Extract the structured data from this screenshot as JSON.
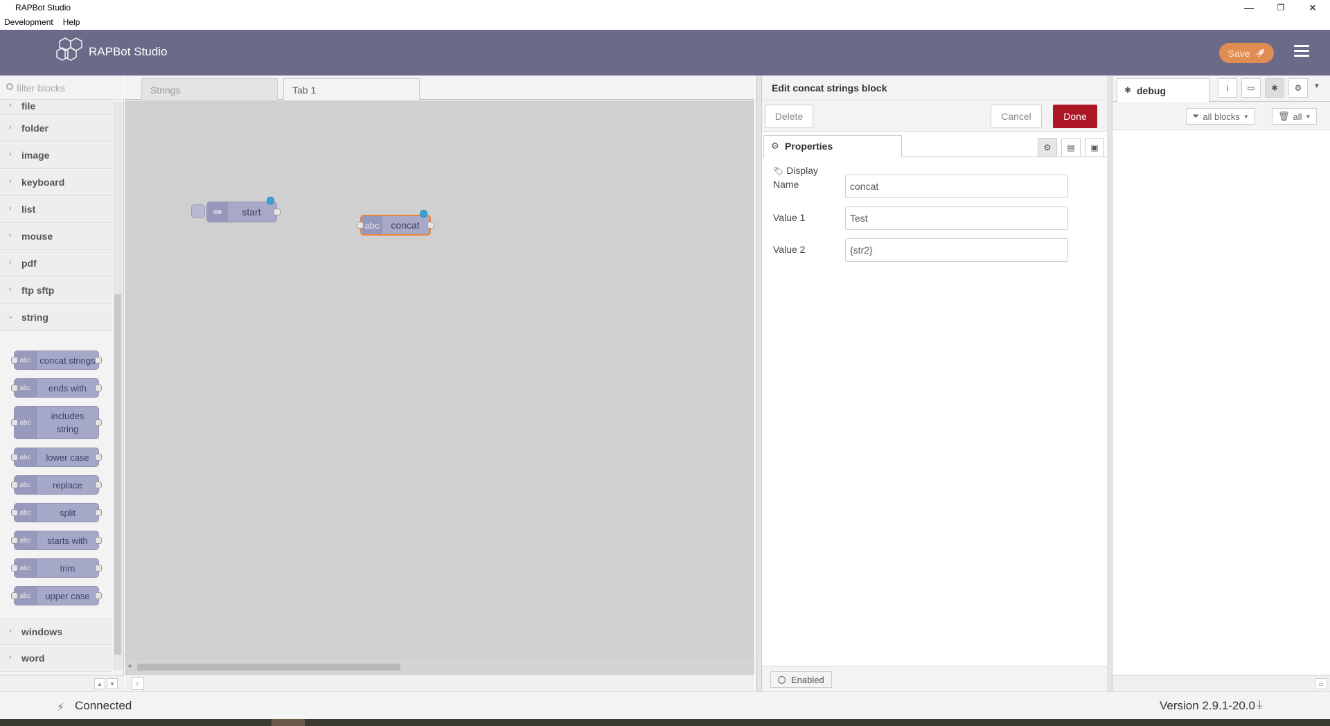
{
  "window": {
    "title": "RAPBot Studio",
    "controls": {
      "minimize": "—",
      "maximize": "❐",
      "close": "✕"
    }
  },
  "menu": {
    "items": [
      "Development",
      "Help"
    ]
  },
  "header": {
    "brand": "RAPBot Studio",
    "save_label": "Save"
  },
  "palette": {
    "filter_placeholder": "filter blocks",
    "categories": [
      "file",
      "folder",
      "image",
      "keyboard",
      "list",
      "mouse",
      "pdf",
      "ftp sftp",
      "string",
      "windows",
      "word"
    ],
    "string_nodes": [
      "concat strings",
      "ends with",
      "includes string",
      "lower case",
      "replace",
      "split",
      "starts with",
      "trim",
      "upper case"
    ],
    "node_icon_text": "abc"
  },
  "workspace": {
    "tabs": [
      "Strings",
      "Tab 1"
    ],
    "nodes": {
      "start": "start",
      "concat": "concat",
      "concat_icon": "abc"
    }
  },
  "editor": {
    "title": "Edit concat strings block",
    "delete_label": "Delete",
    "cancel_label": "Cancel",
    "done_label": "Done",
    "properties_tab": "Properties",
    "fields": {
      "display_name_label_1": "Display",
      "display_name_label_2": "Name",
      "display_name_value": "concat",
      "value1_label": "Value 1",
      "value1_value": "Test",
      "value2_label": "Value 2",
      "value2_value": "{str2}"
    },
    "enabled_label": "Enabled"
  },
  "sidebar": {
    "tab_label": "debug",
    "filter_label": "all blocks",
    "clear_label": "all"
  },
  "status": {
    "connection": "Connected",
    "version": "Version 2.9.1-20.0"
  }
}
